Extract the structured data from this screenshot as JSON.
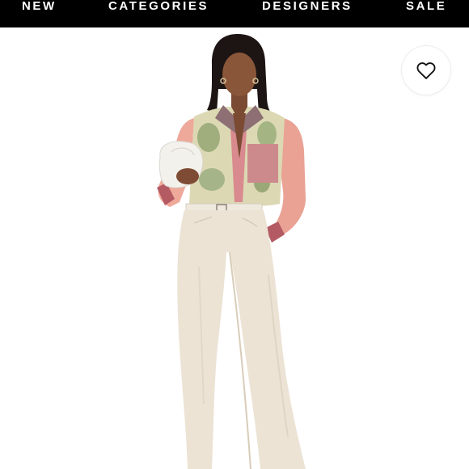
{
  "nav": {
    "items": [
      {
        "label": "NEW"
      },
      {
        "label": "CATEGORIES"
      },
      {
        "label": "DESIGNERS"
      },
      {
        "label": "SALE"
      }
    ]
  },
  "product": {
    "image_icon": "model-photo",
    "wishlist_icon": "heart-outline-icon"
  },
  "colors": {
    "nav_background": "#000000",
    "nav_text": "#ffffff",
    "page_background": "#ffffff"
  }
}
